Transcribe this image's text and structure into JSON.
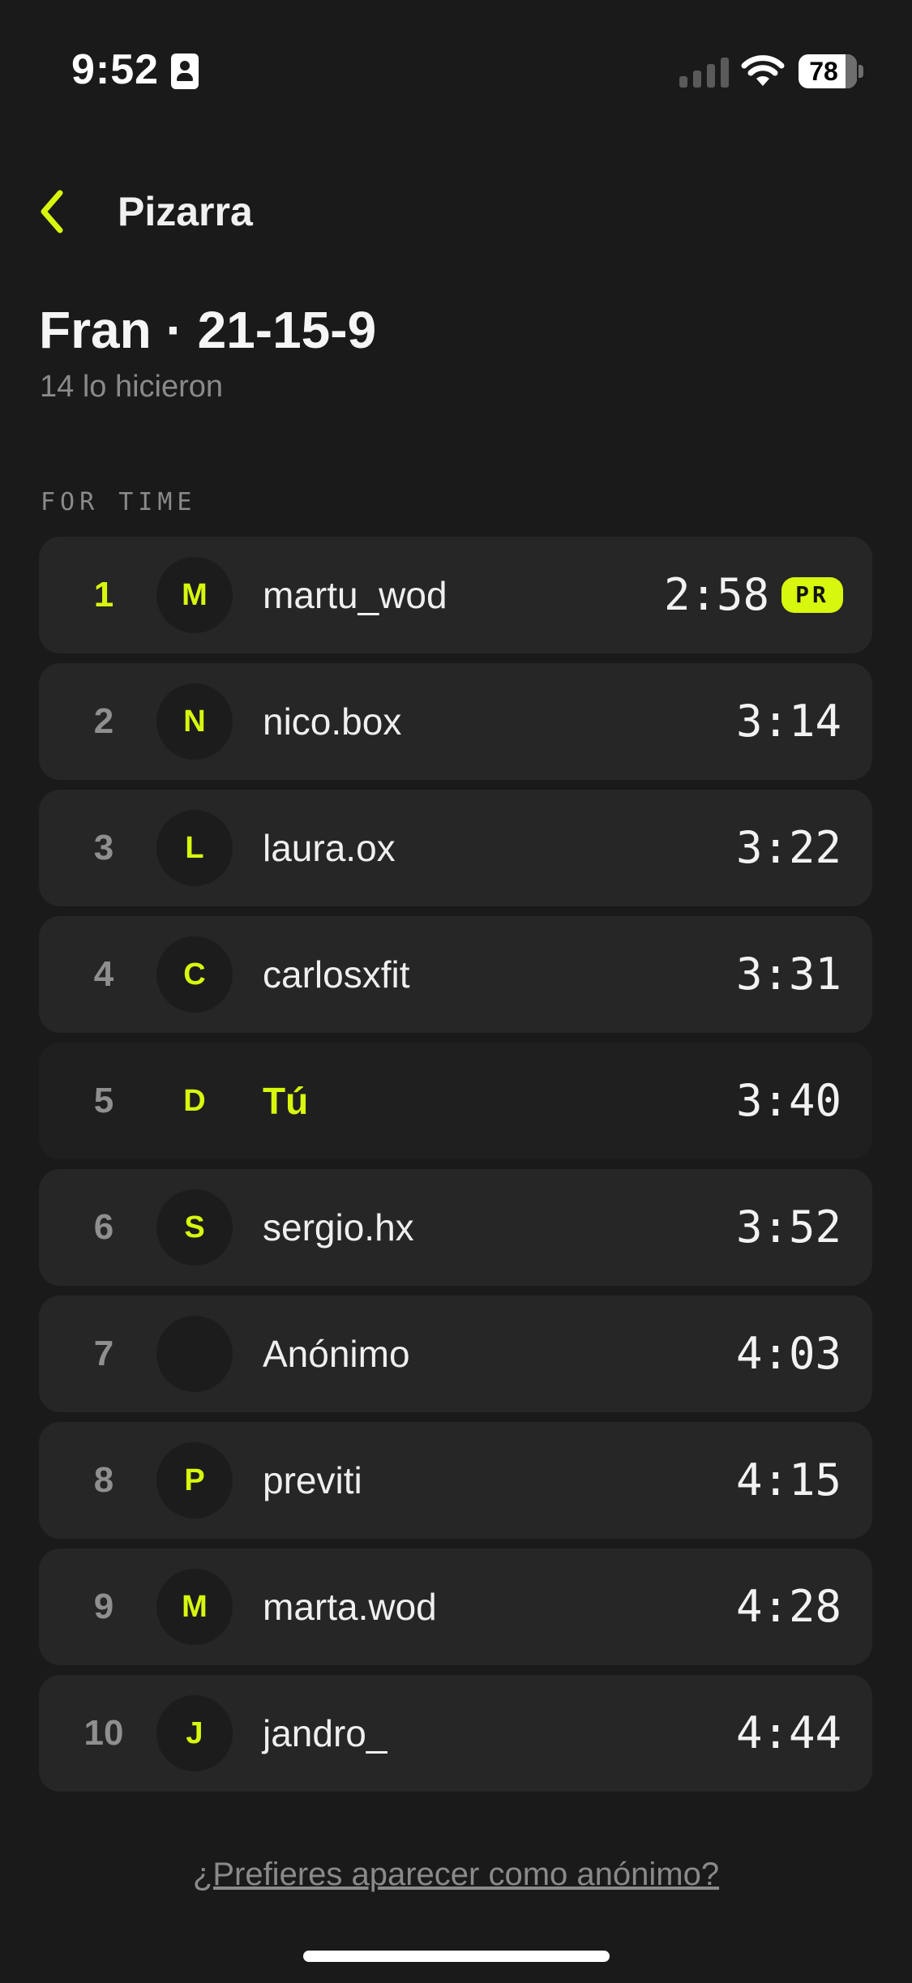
{
  "status_bar": {
    "time": "9:52",
    "battery": "78",
    "icons": [
      "id-card-icon",
      "cellular-signal-icon",
      "wifi-icon",
      "battery-icon"
    ]
  },
  "nav": {
    "back_icon": "chevron-left-icon",
    "title": "Pizarra"
  },
  "header": {
    "title": "Fran · 21-15-9",
    "subtitle": "14 lo hicieron"
  },
  "section_label": "FOR TIME",
  "leaderboard": [
    {
      "rank": "1",
      "initial": "M",
      "name": "martu_wod",
      "time": "2:58",
      "badge": "PR"
    },
    {
      "rank": "2",
      "initial": "N",
      "name": "nico.box",
      "time": "3:14"
    },
    {
      "rank": "3",
      "initial": "L",
      "name": "laura.ox",
      "time": "3:22"
    },
    {
      "rank": "4",
      "initial": "C",
      "name": "carlosxfit",
      "time": "3:31"
    },
    {
      "rank": "5",
      "initial": "D",
      "name": "Tú",
      "time": "3:40"
    },
    {
      "rank": "6",
      "initial": "S",
      "name": "sergio.hx",
      "time": "3:52"
    },
    {
      "rank": "7",
      "initial": "",
      "name": "Anónimo",
      "time": "4:03"
    },
    {
      "rank": "8",
      "initial": "P",
      "name": "previti",
      "time": "4:15"
    },
    {
      "rank": "9",
      "initial": "M",
      "name": "marta.wod",
      "time": "4:28"
    },
    {
      "rank": "10",
      "initial": "J",
      "name": "jandro_",
      "time": "4:44"
    }
  ],
  "footer": {
    "anon_link": "¿Prefieres aparecer como anónimo?"
  },
  "colors": {
    "background": "#1a1a1a",
    "row_background": "#262626",
    "accent": "#d7f70e",
    "muted_text": "#8a8a8a"
  }
}
